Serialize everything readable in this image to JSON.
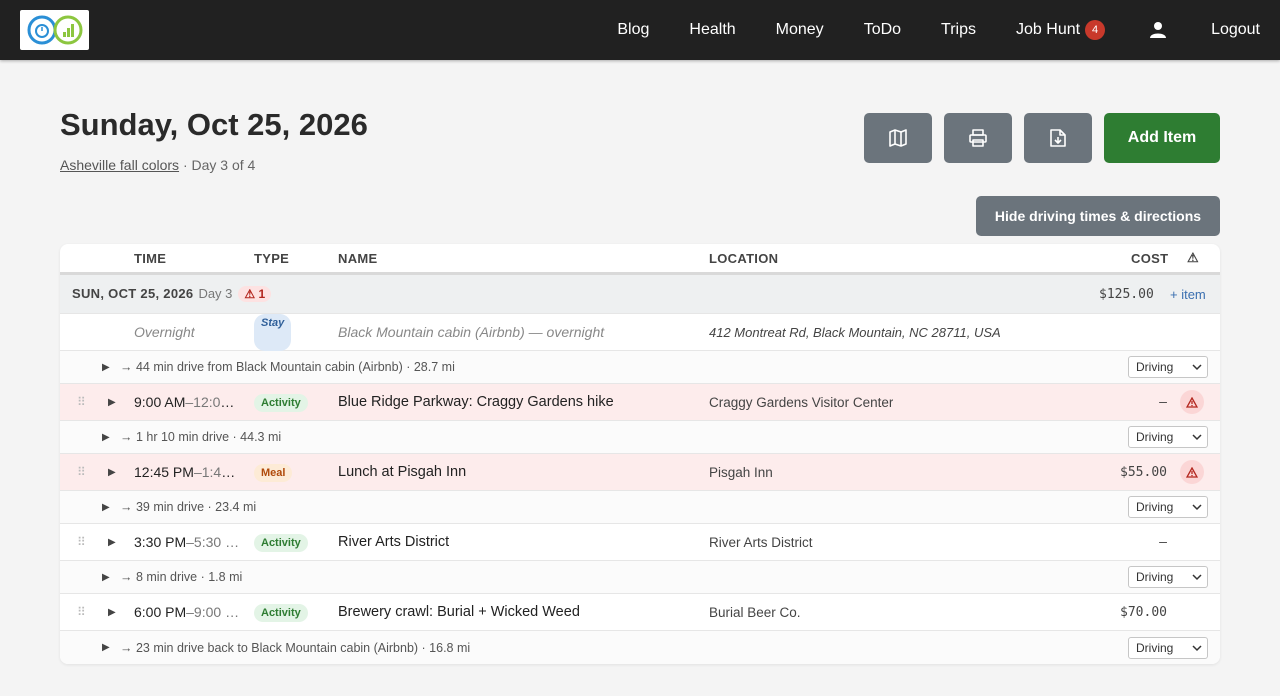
{
  "nav": {
    "items": [
      "Blog",
      "Health",
      "Money",
      "ToDo",
      "Trips",
      "Job Hunt"
    ],
    "job_hunt_badge": "4",
    "logout": "Logout"
  },
  "header": {
    "title": "Sunday, Oct 25, 2026",
    "trip_name": "Asheville fall colors",
    "day_info": " · Day 3 of 4"
  },
  "buttons": {
    "add_item": "Add Item",
    "hide_driving": "Hide driving times & directions"
  },
  "table": {
    "columns": {
      "time": "TIME",
      "type": "TYPE",
      "name": "NAME",
      "location": "LOCATION",
      "cost": "COST",
      "warn": "⚠"
    },
    "day_header": {
      "date": "SUN, OCT 25, 2026",
      "day": "Day 3",
      "warnings": "⚠ 1",
      "total": "$125.00",
      "add": "+ item"
    },
    "stay": {
      "time": "Overnight",
      "type": "Stay",
      "name": "Black Mountain cabin (Airbnb) — overnight",
      "location": "412 Montreat Rd, Black Mountain, NC 28711, USA"
    },
    "drives": [
      {
        "text": "→ 44 min drive from Black Mountain cabin (Airbnb) · 28.7 mi",
        "mode": "Driving"
      },
      {
        "text": "→ 1 hr 10 min drive · 44.3 mi",
        "mode": "Driving"
      },
      {
        "text": "→ 39 min drive · 23.4 mi",
        "mode": "Driving"
      },
      {
        "text": "→ 8 min drive · 1.8 mi",
        "mode": "Driving"
      },
      {
        "text": "→ 23 min drive back to Black Mountain cabin (Airbnb) · 16.8 mi",
        "mode": "Driving"
      }
    ],
    "items": [
      {
        "start": "9:00 AM",
        "end": "–12:00…",
        "type": "Activity",
        "name": "Blue Ridge Parkway: Craggy Gardens hike",
        "location": "Craggy Gardens Visitor Center",
        "cost": "–"
      },
      {
        "start": "12:45 PM",
        "end": "–1:45…",
        "type": "Meal",
        "name": "Lunch at Pisgah Inn",
        "location": "Pisgah Inn",
        "cost": "$55.00"
      },
      {
        "start": "3:30 PM",
        "end": "–5:30 …",
        "type": "Activity",
        "name": "River Arts District",
        "location": "River Arts District",
        "cost": "–"
      },
      {
        "start": "6:00 PM",
        "end": "–9:00 …",
        "type": "Activity",
        "name": "Brewery crawl: Burial + Wicked Weed",
        "location": "Burial Beer Co.",
        "cost": "$70.00"
      }
    ]
  },
  "colors": {
    "nav_bg": "#212121",
    "primary_button": "#2e7d32",
    "secondary_button": "#6b747c",
    "warning_row": "#fdecec"
  }
}
